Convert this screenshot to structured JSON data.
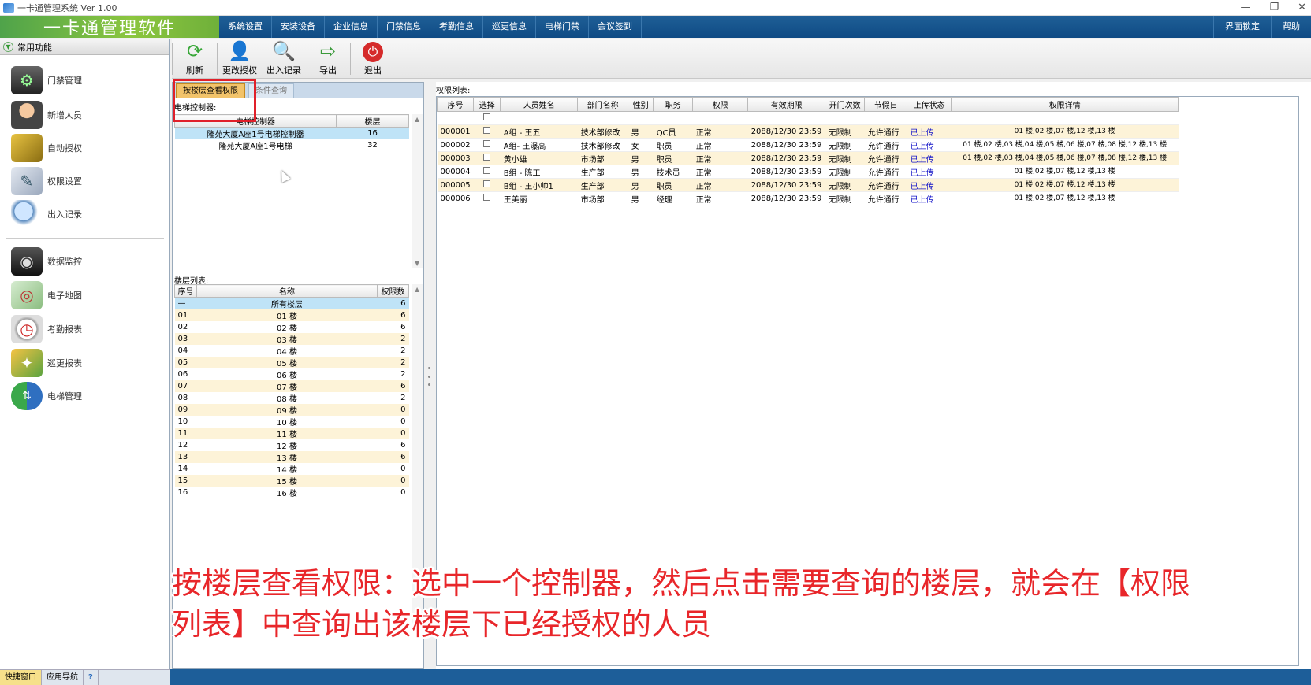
{
  "window": {
    "title": "一卡通管理系统  Ver 1.00",
    "controls": [
      "—",
      "❐",
      "✕"
    ]
  },
  "menubar": {
    "brand": "一卡通管理软件",
    "items": [
      "系统设置",
      "安装设备",
      "企业信息",
      "门禁信息",
      "考勤信息",
      "巡更信息",
      "电梯门禁",
      "会议签到"
    ],
    "right": [
      "界面锁定",
      "帮助"
    ]
  },
  "left_panel": {
    "header": "常用功能",
    "items": [
      {
        "label": "门禁管理",
        "icon": "door-control-icon"
      },
      {
        "label": "新增人员",
        "icon": "add-person-icon"
      },
      {
        "label": "自动授权",
        "icon": "auto-auth-icon"
      },
      {
        "label": "权限设置",
        "icon": "permission-icon"
      },
      {
        "label": "出入记录",
        "icon": "magnifier-icon"
      },
      {
        "label": "数据监控",
        "icon": "camera-icon"
      },
      {
        "label": "电子地图",
        "icon": "map-icon"
      },
      {
        "label": "考勤报表",
        "icon": "clock-icon"
      },
      {
        "label": "巡更报表",
        "icon": "patrol-icon"
      },
      {
        "label": "电梯管理",
        "icon": "elevator-icon"
      }
    ],
    "bottom_tabs": [
      "快捷窗口",
      "应用导航",
      "?"
    ]
  },
  "toolbar": {
    "buttons": [
      {
        "label": "刷新",
        "icon": "refresh-icon"
      },
      {
        "label": "更改授权",
        "icon": "change-auth-icon"
      },
      {
        "label": "出入记录",
        "icon": "search-record-icon"
      },
      {
        "label": "导出",
        "icon": "export-icon"
      },
      {
        "label": "退出",
        "icon": "power-icon"
      }
    ]
  },
  "mid_panel": {
    "tabs": [
      "按楼层查看权限",
      "条件查询"
    ],
    "controller_label": "电梯控制器:",
    "controller_headers": [
      "电梯控制器",
      "楼层"
    ],
    "controllers": [
      {
        "name": "隆苑大厦A座1号电梯控制器",
        "floors": "16"
      },
      {
        "name": "隆苑大厦A座1号电梯",
        "floors": "32"
      }
    ],
    "floor_label": "楼层列表:",
    "floor_headers": [
      "序号",
      "名称",
      "权限数"
    ],
    "floors": [
      [
        "—",
        "所有楼层",
        "6"
      ],
      [
        "01",
        "01 楼",
        "6"
      ],
      [
        "02",
        "02 楼",
        "6"
      ],
      [
        "03",
        "03 楼",
        "2"
      ],
      [
        "04",
        "04 楼",
        "2"
      ],
      [
        "05",
        "05 楼",
        "2"
      ],
      [
        "06",
        "06 楼",
        "2"
      ],
      [
        "07",
        "07 楼",
        "6"
      ],
      [
        "08",
        "08 楼",
        "2"
      ],
      [
        "09",
        "09 楼",
        "0"
      ],
      [
        "10",
        "10 楼",
        "0"
      ],
      [
        "11",
        "11 楼",
        "0"
      ],
      [
        "12",
        "12 楼",
        "6"
      ],
      [
        "13",
        "13 楼",
        "6"
      ],
      [
        "14",
        "14 楼",
        "0"
      ],
      [
        "15",
        "15 楼",
        "0"
      ],
      [
        "16",
        "16 楼",
        "0"
      ]
    ]
  },
  "permission_list": {
    "label": "权限列表:",
    "headers": [
      "序号",
      "选择",
      "人员姓名",
      "部门名称",
      "性别",
      "职务",
      "权限",
      "有效期限",
      "开门次数",
      "节假日",
      "上传状态",
      "权限详情"
    ],
    "rows": [
      [
        "000001",
        "",
        "A组 - 王五",
        "技术部修改",
        "男",
        "QC员",
        "正常",
        "2088/12/30 23:59",
        "无限制",
        "允许通行",
        "已上传",
        "01 楼,02 楼,07 楼,12 楼,13 楼"
      ],
      [
        "000002",
        "",
        "A组- 王瀑高",
        "技术部修改",
        "女",
        "职员",
        "正常",
        "2088/12/30 23:59",
        "无限制",
        "允许通行",
        "已上传",
        "01 楼,02 楼,03 楼,04 楼,05 楼,06 楼,07 楼,08 楼,12 楼,13 楼"
      ],
      [
        "000003",
        "",
        "黄小雄",
        "市场部",
        "男",
        "职员",
        "正常",
        "2088/12/30 23:59",
        "无限制",
        "允许通行",
        "已上传",
        "01 楼,02 楼,03 楼,04 楼,05 楼,06 楼,07 楼,08 楼,12 楼,13 楼"
      ],
      [
        "000004",
        "",
        "B组 - 陈工",
        "生产部",
        "男",
        "技术员",
        "正常",
        "2088/12/30 23:59",
        "无限制",
        "允许通行",
        "已上传",
        "01 楼,02 楼,07 楼,12 楼,13 楼"
      ],
      [
        "000005",
        "",
        "B组 - 王小帅1",
        "生产部",
        "男",
        "职员",
        "正常",
        "2088/12/30 23:59",
        "无限制",
        "允许通行",
        "已上传",
        "01 楼,02 楼,07 楼,12 楼,13 楼"
      ],
      [
        "000006",
        "",
        "王美丽",
        "市场部",
        "男",
        "经理",
        "正常",
        "2088/12/30 23:59",
        "无限制",
        "允许通行",
        "已上传",
        "01 楼,02 楼,07 楼,12 楼,13 楼"
      ]
    ]
  },
  "caption": {
    "line1": "按楼层查看权限：选中一个控制器，然后点击需要查询的楼层，就会在【权限",
    "line2": "列表】中查询出该楼层下已经授权的人员"
  },
  "colors": {
    "highlight_box": "#e0202a",
    "menubar": "#1f5f97",
    "caption": "#e8262a"
  }
}
